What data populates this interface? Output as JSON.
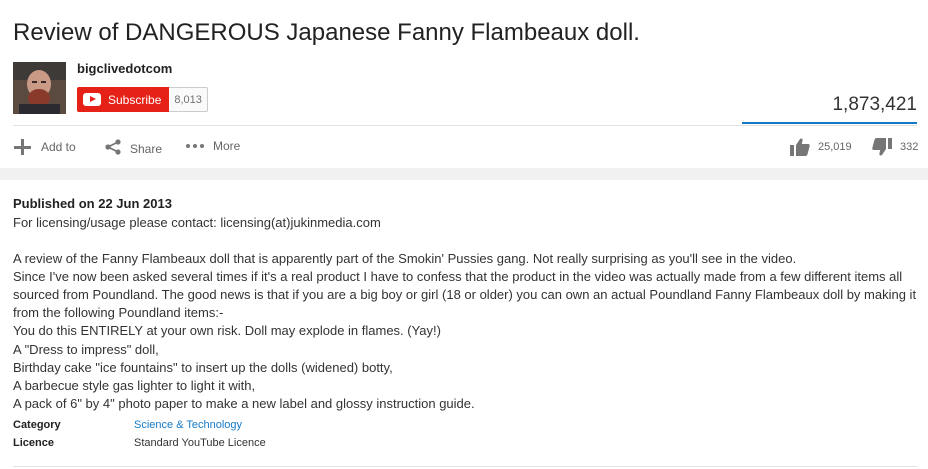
{
  "video": {
    "title": "Review of DANGEROUS Japanese Fanny Flambeaux doll.",
    "views": "1,873,421",
    "likes": "25,019",
    "dislikes": "332"
  },
  "channel": {
    "name": "bigclivedotcom",
    "subscribe_label": "Subscribe",
    "subscriber_count": "8,013"
  },
  "actions": {
    "add_to": "Add to",
    "share": "Share",
    "more": "More"
  },
  "description": {
    "published": "Published on 22 Jun 2013",
    "lines": [
      "For licensing/usage please contact: licensing(at)jukinmedia.com",
      "",
      "A review of the Fanny Flambeaux doll that is apparently part of the Smokin' Pussies gang. Not really surprising as you'll see in the video.",
      "Since I've now been asked several times if it's a real product I have to confess that the product in the video was actually made from a few different items all sourced from Poundland. The good news is that if you are a big boy or girl (18 or older) you can own an actual Poundland Fanny Flambeaux doll by making it from the following Poundland items:-",
      "You do this ENTIRELY at your own risk. Doll may explode in flames. (Yay!)",
      "A \"Dress to impress\" doll,",
      "Birthday cake \"ice fountains\" to insert up the dolls (widened) botty,",
      "A barbecue style gas lighter to light it with,",
      "A pack of 6\" by 4\" photo paper to make a new label and glossy instruction guide."
    ],
    "category_label": "Category",
    "category_value": "Science & Technology",
    "licence_label": "Licence",
    "licence_value": "Standard YouTube Licence"
  },
  "icons": {
    "add": "plus-icon",
    "share": "share-icon",
    "more": "more-dots-icon",
    "like": "thumbs-up-icon",
    "dislike": "thumbs-down-icon"
  },
  "colors": {
    "subscribe_red": "#e62117",
    "link_blue": "#167ac6",
    "views_bar": "#167ac6"
  }
}
